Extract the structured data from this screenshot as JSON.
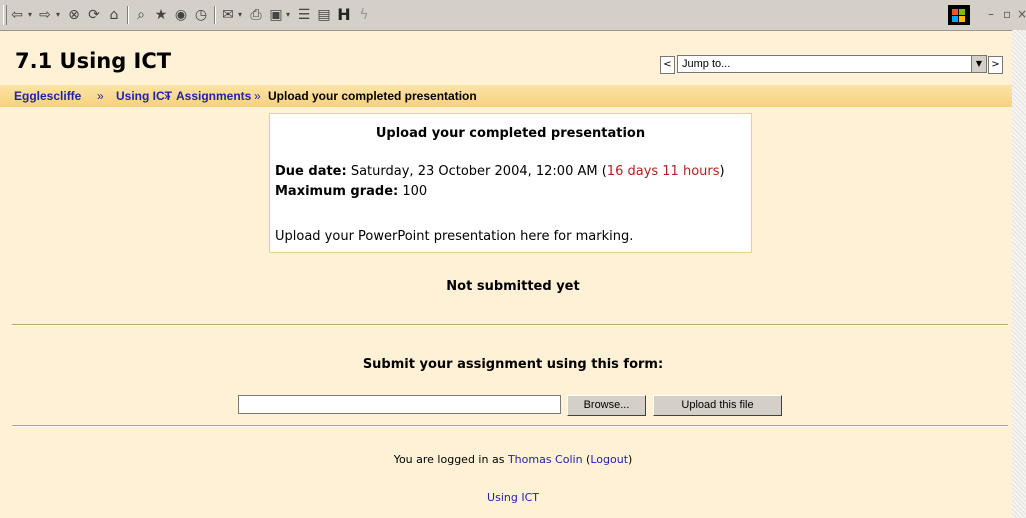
{
  "page": {
    "title": "7.1 Using ICT",
    "jump_to": "Jump to...",
    "nav_prev": "<",
    "nav_next": ">"
  },
  "breadcrumb": {
    "items": [
      "Egglescliffe",
      "Using ICT",
      "Assignments"
    ],
    "separator": "»",
    "current": "Upload your completed presentation"
  },
  "assignment": {
    "title": "Upload your completed presentation",
    "due_label": "Due date:",
    "due_value": "Saturday, 23 October 2004, 12:00 AM",
    "time_left": "16 days 11 hours",
    "grade_label": "Maximum grade:",
    "grade_value": "100",
    "description": "Upload your PowerPoint presentation here for marking."
  },
  "status": "Not submitted yet",
  "form": {
    "title": "Submit your assignment using this form:",
    "file_value": "",
    "browse_label": "Browse...",
    "upload_label": "Upload this file"
  },
  "footer": {
    "login_prefix": "You are logged in as",
    "user": "Thomas Colin",
    "logout": "Logout",
    "course_link": "Using ICT"
  },
  "toolbar": {
    "icons": [
      "back-icon",
      "forward-icon",
      "stop-icon",
      "refresh-icon",
      "home-icon",
      "search-icon",
      "favorites-icon",
      "media-icon",
      "history-icon",
      "mail-icon",
      "print-icon",
      "edit-icon",
      "discuss-icon",
      "messenger-icon",
      "h-icon",
      "plugin-icon"
    ],
    "h_label": "H"
  },
  "colors": {
    "background": "#fef1d6",
    "breadcrumb_bar": "#f6d27e",
    "link": "#2222aa",
    "time_left": "#b22222"
  }
}
